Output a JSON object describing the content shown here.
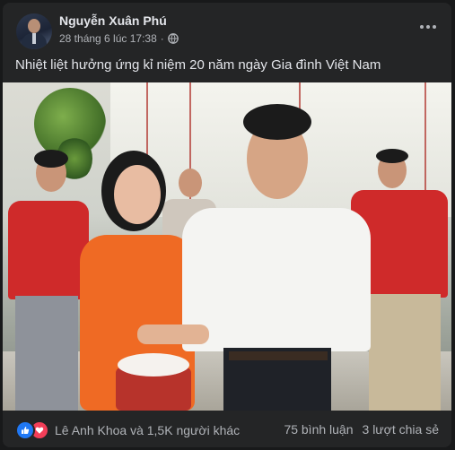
{
  "post": {
    "author": "Nguyễn Xuân Phú",
    "timestamp": "28 tháng 6 lúc 17:38",
    "privacy_sep": "·",
    "privacy_icon": "globe-icon",
    "text": "Nhiệt liệt hưởng ứng kỉ niệm 20 năm ngày Gia đình Việt Nam",
    "more_icon": "more-options-icon"
  },
  "photo": {
    "subject": "photo"
  },
  "footer": {
    "reaction_icons": [
      "like-icon",
      "love-icon"
    ],
    "reactors": "Lê Anh Khoa và 1,5K người khác",
    "comments": "75 bình luận",
    "shares": "3 lượt chia sẻ"
  },
  "colors": {
    "card_bg": "#242526",
    "text_primary": "#e4e6eb",
    "text_secondary": "#b0b3b8",
    "like_blue": "#2078f4",
    "love_red": "#f33e58"
  }
}
